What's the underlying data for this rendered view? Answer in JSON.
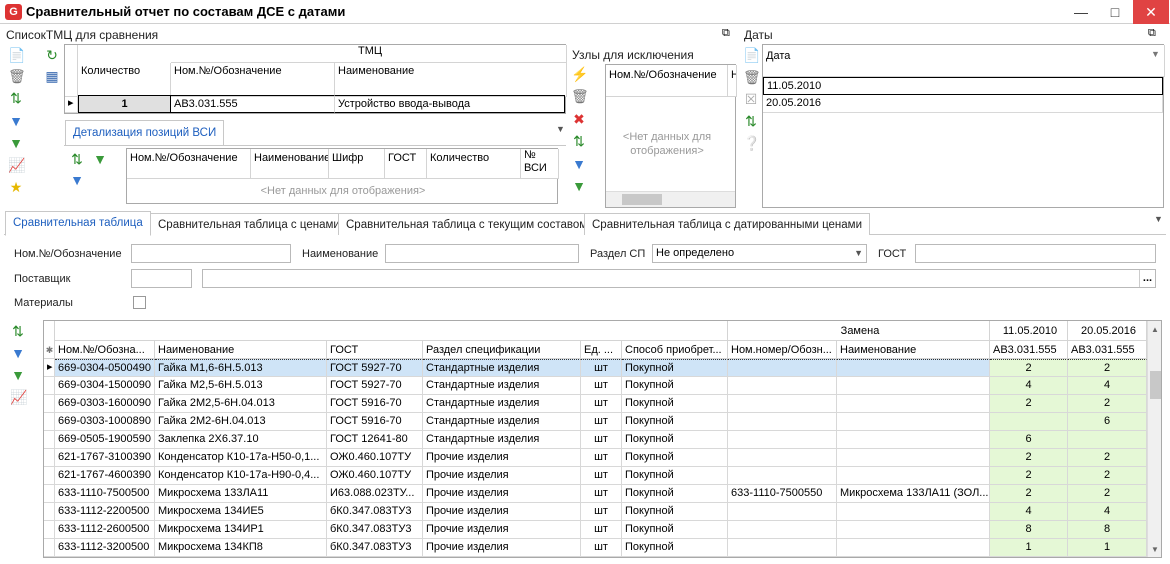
{
  "window": {
    "title": "Сравнительный отчет по составам ДСЕ с датами"
  },
  "tmc_panel": {
    "title": "СписокТМЦ для сравнения",
    "group_header": "ТМЦ",
    "columns": [
      "Количество",
      "Ном.№/Обозначение",
      "Наименование"
    ],
    "rows": [
      {
        "qty": "1",
        "code": "АВ3.031.555",
        "name": "Устройство ввода-вывода"
      }
    ]
  },
  "detail_panel": {
    "tab": "Детализация позиций ВСИ",
    "columns": [
      "Ном.№/Обозначение",
      "Наименование",
      "Шифр",
      "ГОСТ",
      "Количество",
      "№ ВСИ"
    ],
    "empty": "<Нет данных для отображения>"
  },
  "exclude_panel": {
    "title": "Узлы для исключения",
    "columns": [
      "Ном.№/Обозначение",
      "Н"
    ],
    "empty_line1": "<Нет данных для",
    "empty_line2": "отображения>"
  },
  "dates_panel": {
    "title": "Даты",
    "column": "Дата",
    "rows": [
      "11.05.2010",
      "20.05.2016"
    ]
  },
  "tabs": [
    "Сравнительная таблица",
    "Сравнительная таблица с ценами",
    "Сравнительная таблица с текущим составом",
    "Сравнительная таблица с датированными ценами"
  ],
  "filters": {
    "nom_label": "Ном.№/Обозначение",
    "name_label": "Наименование",
    "section_label": "Раздел СП",
    "section_value": "Не определено",
    "gost_label": "ГОСТ",
    "supplier_label": "Поставщик",
    "materials_label": "Материалы",
    "more_btn": "..."
  },
  "main_table": {
    "group_zamena": "Замена",
    "date1": "11.05.2010",
    "date2": "20.05.2016",
    "columns": [
      "Ном.№/Обозна...",
      "Наименование",
      "ГОСТ",
      "Раздел спецификации",
      "Ед. ...",
      "Способ приобрет...",
      "Ном.номер/Обозн...",
      "Наименование",
      "АВ3.031.555",
      "АВ3.031.555"
    ],
    "rows": [
      {
        "code": "669-0304-0500490",
        "name": "Гайка М1,6-6Н.5.013",
        "gost": "ГОСТ 5927-70",
        "section": "Стандартные изделия",
        "unit": "шт",
        "method": "Покупной",
        "rcode": "",
        "rname": "",
        "v1": "2",
        "v2": "2"
      },
      {
        "code": "669-0304-1500090",
        "name": "Гайка М2,5-6Н.5.013",
        "gost": "ГОСТ 5927-70",
        "section": "Стандартные изделия",
        "unit": "шт",
        "method": "Покупной",
        "rcode": "",
        "rname": "",
        "v1": "4",
        "v2": "4"
      },
      {
        "code": "669-0303-1600090",
        "name": "Гайка 2М2,5-6Н.04.013",
        "gost": "ГОСТ 5916-70",
        "section": "Стандартные изделия",
        "unit": "шт",
        "method": "Покупной",
        "rcode": "",
        "rname": "",
        "v1": "2",
        "v2": "2"
      },
      {
        "code": "669-0303-1000890",
        "name": "Гайка 2М2-6Н.04.013",
        "gost": "ГОСТ 5916-70",
        "section": "Стандартные изделия",
        "unit": "шт",
        "method": "Покупной",
        "rcode": "",
        "rname": "",
        "v1": "",
        "v2": "6"
      },
      {
        "code": "669-0505-1900590",
        "name": "Заклепка 2Х6.37.10",
        "gost": "ГОСТ 12641-80",
        "section": "Стандартные изделия",
        "unit": "шт",
        "method": "Покупной",
        "rcode": "",
        "rname": "",
        "v1": "6",
        "v2": ""
      },
      {
        "code": "621-1767-3100390",
        "name": "Конденсатор К10-17а-Н50-0,1...",
        "gost": "ОЖ0.460.107ТУ",
        "section": "Прочие изделия",
        "unit": "шт",
        "method": "Покупной",
        "rcode": "",
        "rname": "",
        "v1": "2",
        "v2": "2"
      },
      {
        "code": "621-1767-4600390",
        "name": "Конденсатор К10-17а-Н90-0,4...",
        "gost": "ОЖ0.460.107ТУ",
        "section": "Прочие изделия",
        "unit": "шт",
        "method": "Покупной",
        "rcode": "",
        "rname": "",
        "v1": "2",
        "v2": "2"
      },
      {
        "code": "633-1110-7500500",
        "name": "Микросхема 133ЛА11",
        "gost": "И63.088.023ТУ...",
        "section": "Прочие изделия",
        "unit": "шт",
        "method": "Покупной",
        "rcode": "633-1110-7500550",
        "rname": "Микросхема 133ЛА11 (ЗОЛ...",
        "v1": "2",
        "v2": "2"
      },
      {
        "code": "633-1112-2200500",
        "name": "Микросхема 134ИЕ5",
        "gost": "бК0.347.083ТУ3",
        "section": "Прочие изделия",
        "unit": "шт",
        "method": "Покупной",
        "rcode": "",
        "rname": "",
        "v1": "4",
        "v2": "4"
      },
      {
        "code": "633-1112-2600500",
        "name": "Микросхема 134ИР1",
        "gost": "бК0.347.083ТУ3",
        "section": "Прочие изделия",
        "unit": "шт",
        "method": "Покупной",
        "rcode": "",
        "rname": "",
        "v1": "8",
        "v2": "8"
      },
      {
        "code": "633-1112-3200500",
        "name": "Микросхема 134КП8",
        "gost": "бК0.347.083ТУ3",
        "section": "Прочие изделия",
        "unit": "шт",
        "method": "Покупной",
        "rcode": "",
        "rname": "",
        "v1": "1",
        "v2": "1"
      }
    ]
  }
}
